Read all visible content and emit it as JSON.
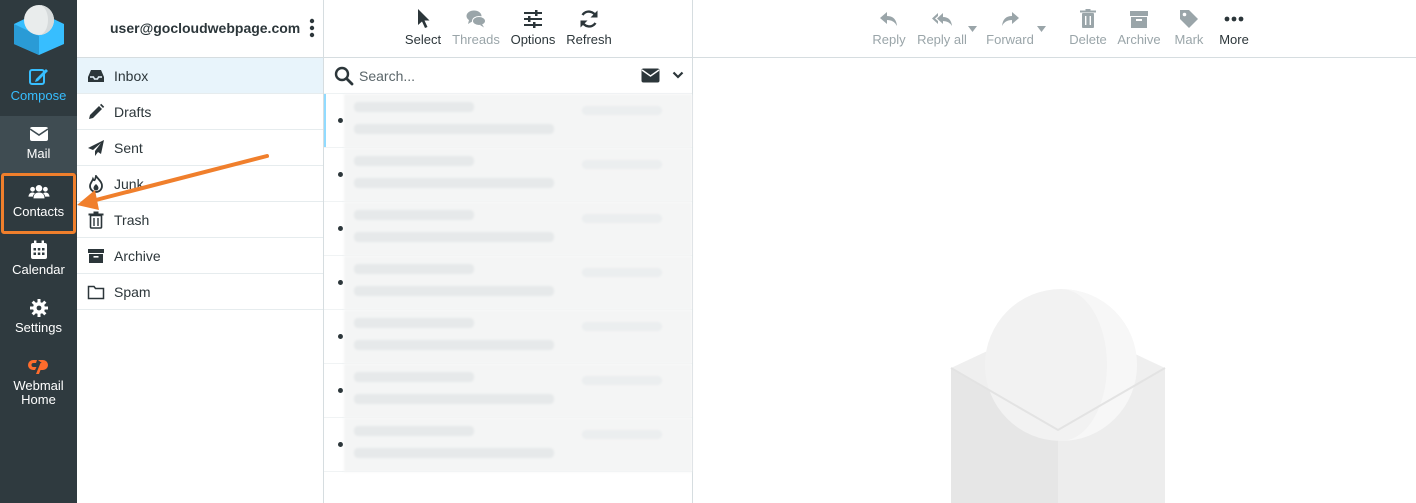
{
  "nav": {
    "compose": "Compose",
    "mail": "Mail",
    "contacts": "Contacts",
    "calendar": "Calendar",
    "settings": "Settings",
    "webmail_home_1": "Webmail",
    "webmail_home_2": "Home"
  },
  "account": {
    "email": "user@gocloudwebpage.com"
  },
  "folders": [
    {
      "label": "Inbox",
      "icon": "inbox-icon"
    },
    {
      "label": "Drafts",
      "icon": "pencil-icon"
    },
    {
      "label": "Sent",
      "icon": "paper-plane-icon"
    },
    {
      "label": "Junk",
      "icon": "fire-icon"
    },
    {
      "label": "Trash",
      "icon": "trash-icon"
    },
    {
      "label": "Archive",
      "icon": "archive-icon"
    },
    {
      "label": "Spam",
      "icon": "folder-icon"
    }
  ],
  "list_toolbar": {
    "select": "Select",
    "threads": "Threads",
    "options": "Options",
    "refresh": "Refresh"
  },
  "search": {
    "placeholder": "Search..."
  },
  "message_toolbar": {
    "reply": "Reply",
    "reply_all": "Reply all",
    "forward": "Forward",
    "delete": "Delete",
    "archive": "Archive",
    "mark": "Mark",
    "more": "More"
  },
  "colors": {
    "nav_bg": "#2f3a3f",
    "accent": "#37beff",
    "highlight": "#f07f2c",
    "selected_folder": "#e8f4fb"
  }
}
